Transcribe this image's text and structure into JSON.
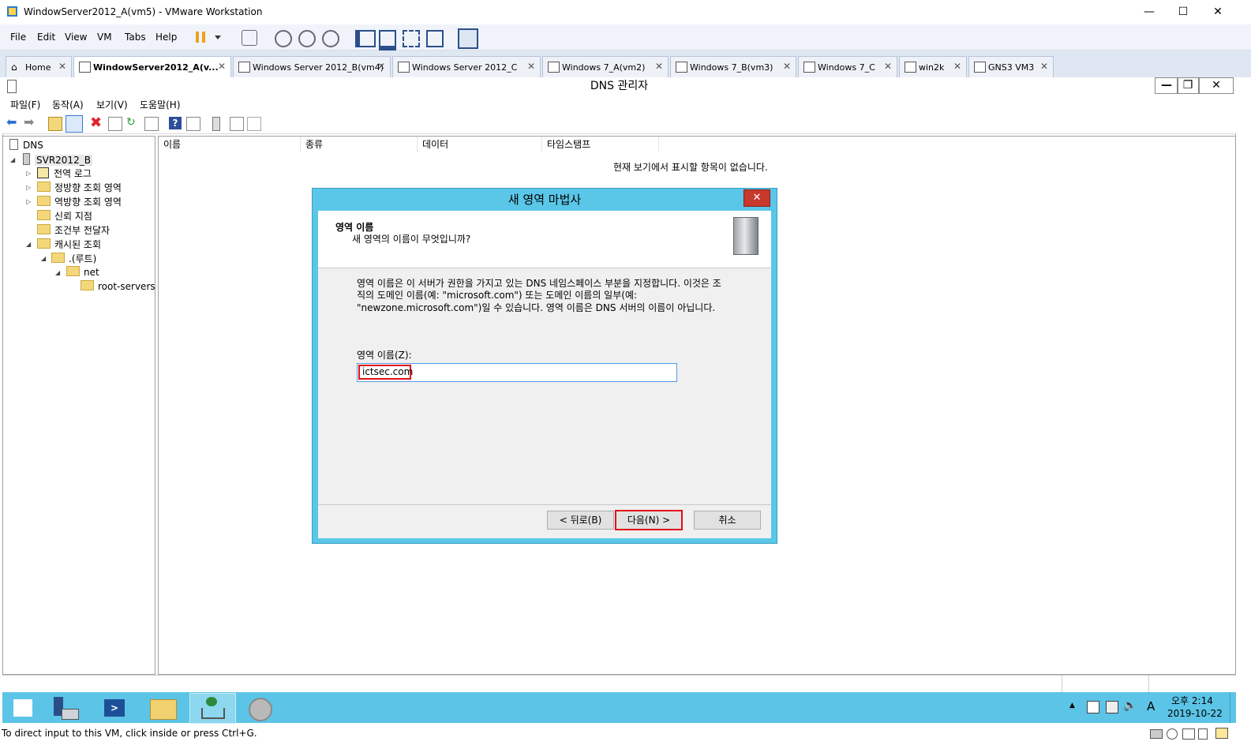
{
  "vmware": {
    "title": "WindowServer2012_A(vm5) - VMware Workstation",
    "menu": [
      "File",
      "Edit",
      "View",
      "VM",
      "Tabs",
      "Help"
    ],
    "tabs": [
      {
        "label": "Home",
        "active": false
      },
      {
        "label": "WindowServer2012_A(v...",
        "active": true
      },
      {
        "label": "Windows Server 2012_B(vm4)",
        "active": false
      },
      {
        "label": "Windows Server 2012_C",
        "active": false
      },
      {
        "label": "Windows 7_A(vm2)",
        "active": false
      },
      {
        "label": "Windows 7_B(vm3)",
        "active": false
      },
      {
        "label": "Windows 7_C",
        "active": false
      },
      {
        "label": "win2k",
        "active": false
      },
      {
        "label": "GNS3 VM3",
        "active": false
      }
    ],
    "status_text": "To direct input to this VM, click inside or press Ctrl+G."
  },
  "dns": {
    "title": "DNS 관리자",
    "menu": [
      "파일(F)",
      "동작(A)",
      "보기(V)",
      "도움말(H)"
    ],
    "tree": {
      "root": "DNS",
      "server": "SVR2012_B",
      "items": [
        "전역 로그",
        "정방향 조회 영역",
        "역방향 조회 영역",
        "신뢰 지점",
        "조건부 전달자",
        "캐시된 조회"
      ],
      "cached_root": ".(루트)",
      "net": "net",
      "root_servers": "root-servers"
    },
    "columns": [
      "이름",
      "종류",
      "데이터",
      "타임스탬프"
    ],
    "empty_message": "현재 보기에서 표시할 항목이 없습니다."
  },
  "dialog": {
    "title": "새 영역 마법사",
    "header_title": "영역 이름",
    "header_subtitle": "새 영역의 이름이 무엇입니까?",
    "description_line1": "영역 이름은 이 서버가 권한을 가지고 있는 DNS 네임스페이스 부분을 지정합니다. 이것은 조",
    "description_line2": "직의 도메인 이름(예: \"microsoft.com\") 또는 도메인 이름의 일부(예:",
    "description_line3": "\"newzone.microsoft.com\")일 수 있습니다. 영역 이름은 DNS 서버의 이름이 아닙니다.",
    "field_label": "영역 이름(Z):",
    "field_value": "ictsec.com",
    "back_label": "< 뒤로(B)",
    "next_label": "다음(N) >",
    "cancel_label": "취소",
    "highlight_color": "#e0101a"
  },
  "taskbar": {
    "time": "오후 2:14",
    "date": "2019-10-22",
    "ime": "A"
  }
}
